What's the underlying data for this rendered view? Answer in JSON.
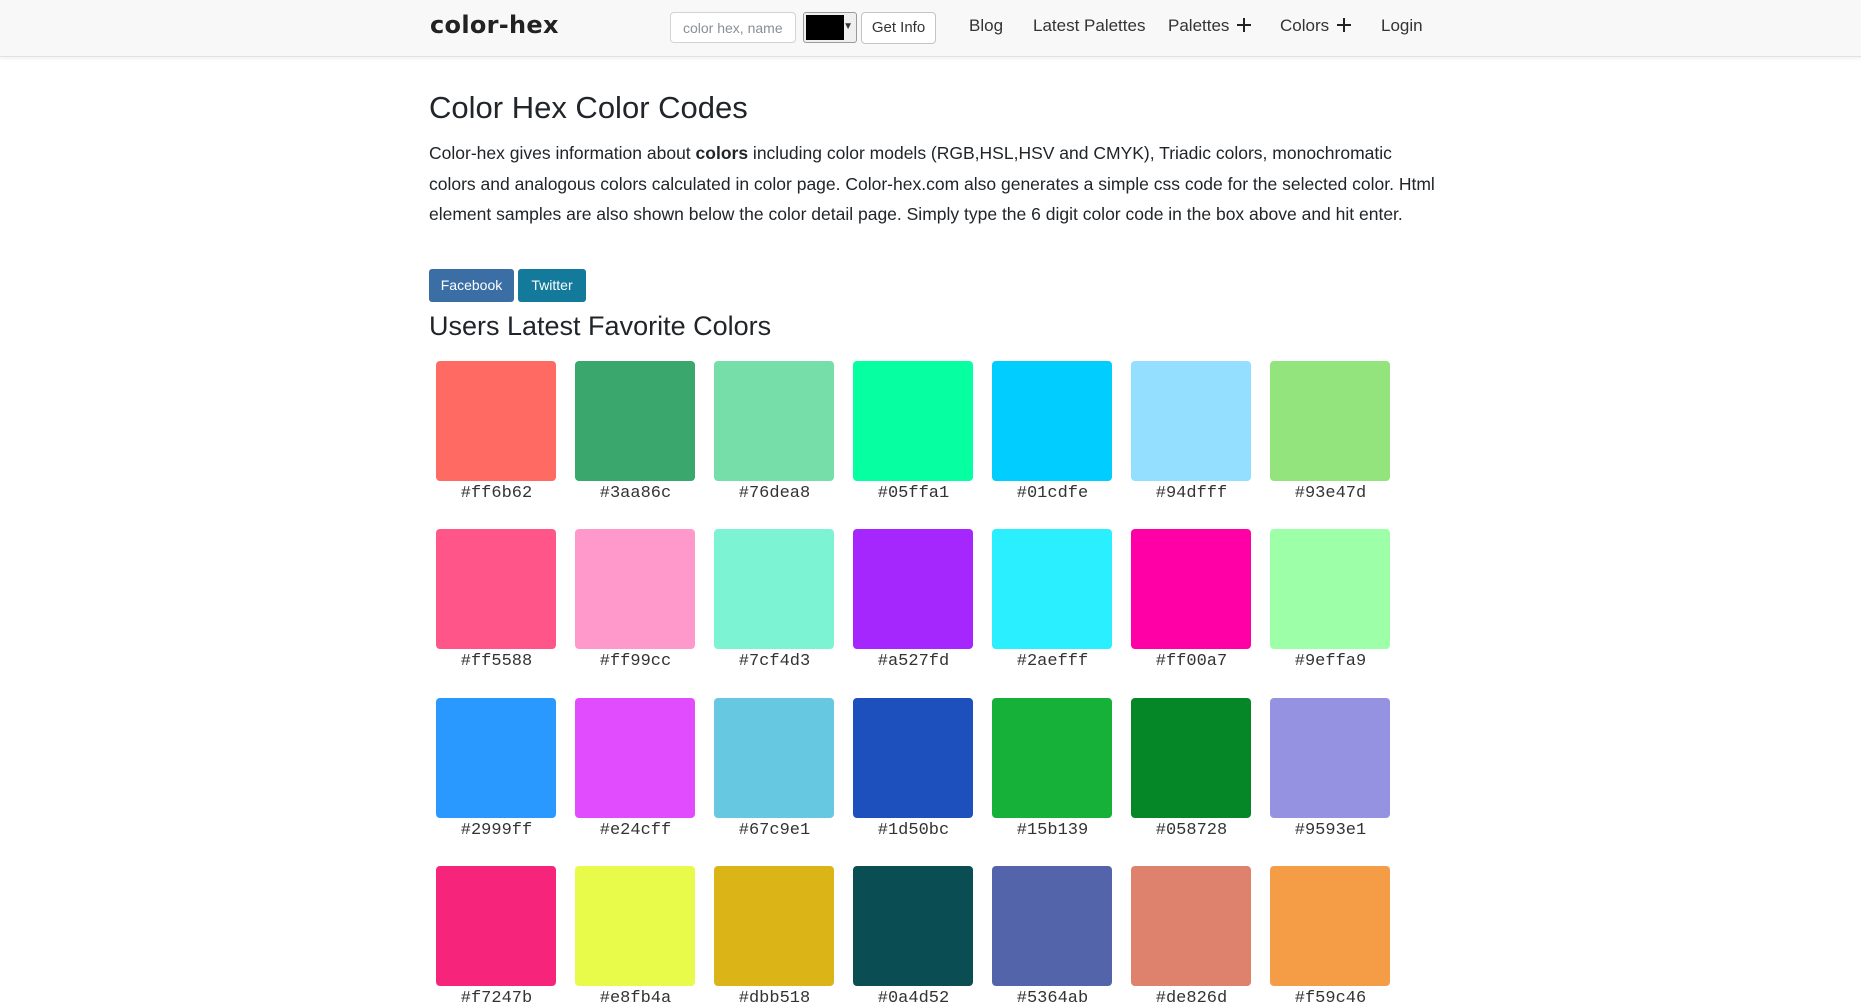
{
  "nav": {
    "brand": "color-hex",
    "search_placeholder": "color hex, name...",
    "picker_color": "#000000",
    "get_info_label": "Get Info",
    "links": {
      "blog": "Blog",
      "latest_palettes": "Latest Palettes",
      "palettes": "Palettes",
      "colors": "Colors",
      "login": "Login"
    }
  },
  "main": {
    "title": "Color Hex Color Codes",
    "intro_before": "Color-hex gives information about ",
    "intro_bold": "colors",
    "intro_after": " including color models (RGB,HSL,HSV and CMYK), Triadic colors, monochromatic colors and analogous colors calculated in color page. Color-hex.com also generates a simple css code for the selected color. Html element samples are also shown below the color detail page. Simply type the 6 digit color code in the box above and hit enter.",
    "facebook_label": "Facebook",
    "twitter_label": "Twitter",
    "favorites_heading": "Users Latest Favorite Colors"
  },
  "colors": [
    [
      "#ff6b62",
      "#3aa86c",
      "#76dea8",
      "#05ffa1",
      "#01cdfe",
      "#94dfff",
      "#93e47d"
    ],
    [
      "#ff5588",
      "#ff99cc",
      "#7cf4d3",
      "#a527fd",
      "#2aefff",
      "#ff00a7",
      "#9effa9"
    ],
    [
      "#2999ff",
      "#e24cff",
      "#67c9e1",
      "#1d50bc",
      "#15b139",
      "#058728",
      "#9593e1"
    ],
    [
      "#f7247b",
      "#e8fb4a",
      "#dbb518",
      "#0a4d52",
      "#5364ab",
      "#de826d",
      "#f59c46"
    ]
  ]
}
